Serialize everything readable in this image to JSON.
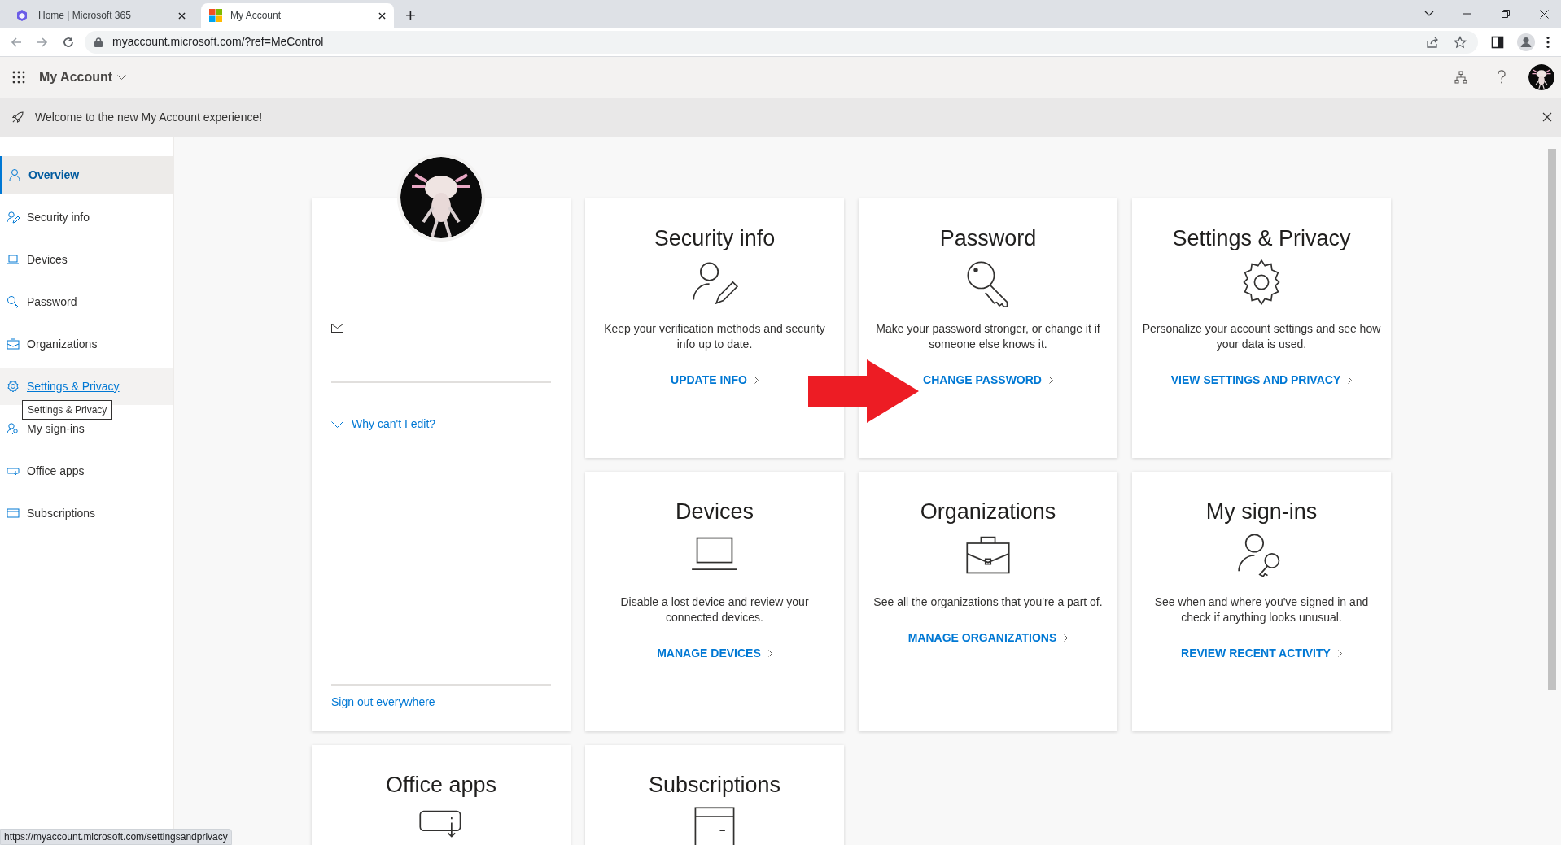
{
  "browser": {
    "tabs": [
      {
        "title": "Home | Microsoft 365",
        "selected": false
      },
      {
        "title": "My Account",
        "selected": true
      }
    ],
    "new_tab": "+",
    "address": "myaccount.microsoft.com/?ref=MeControl",
    "status_url": "https://myaccount.microsoft.com/settingsandprivacy"
  },
  "header": {
    "app_title": "My Account"
  },
  "banner": {
    "text": "Welcome to the new My Account experience!"
  },
  "sidebar": {
    "items": [
      {
        "label": "Overview",
        "selected": true,
        "hovered": false
      },
      {
        "label": "Security info",
        "selected": false,
        "hovered": false
      },
      {
        "label": "Devices",
        "selected": false,
        "hovered": false
      },
      {
        "label": "Password",
        "selected": false,
        "hovered": false
      },
      {
        "label": "Organizations",
        "selected": false,
        "hovered": false
      },
      {
        "label": "Settings & Privacy",
        "selected": false,
        "hovered": true
      },
      {
        "label": "My sign-ins",
        "selected": false,
        "hovered": false
      },
      {
        "label": "Office apps",
        "selected": false,
        "hovered": false
      },
      {
        "label": "Subscriptions",
        "selected": false,
        "hovered": false
      }
    ],
    "tooltip": "Settings & Privacy"
  },
  "profile_card": {
    "why_cant_edit": "Why can't I edit?",
    "sign_out": "Sign out everywhere"
  },
  "cards": [
    {
      "title": "Security info",
      "description": "Keep your verification methods and security info up to date.",
      "link": "UPDATE INFO"
    },
    {
      "title": "Password",
      "description": "Make your password stronger, or change it if someone else knows it.",
      "link": "CHANGE PASSWORD"
    },
    {
      "title": "Settings & Privacy",
      "description": "Personalize your account settings and see how your data is used.",
      "link": "VIEW SETTINGS AND PRIVACY"
    },
    {
      "title": "Devices",
      "description": "Disable a lost device and review your connected devices.",
      "link": "MANAGE DEVICES"
    },
    {
      "title": "Organizations",
      "description": "See all the organizations that you're a part of.",
      "link": "MANAGE ORGANIZATIONS"
    },
    {
      "title": "My sign-ins",
      "description": "See when and where you've signed in and check if anything looks unusual.",
      "link": "REVIEW RECENT ACTIVITY"
    },
    {
      "title": "Office apps"
    },
    {
      "title": "Subscriptions"
    }
  ]
}
